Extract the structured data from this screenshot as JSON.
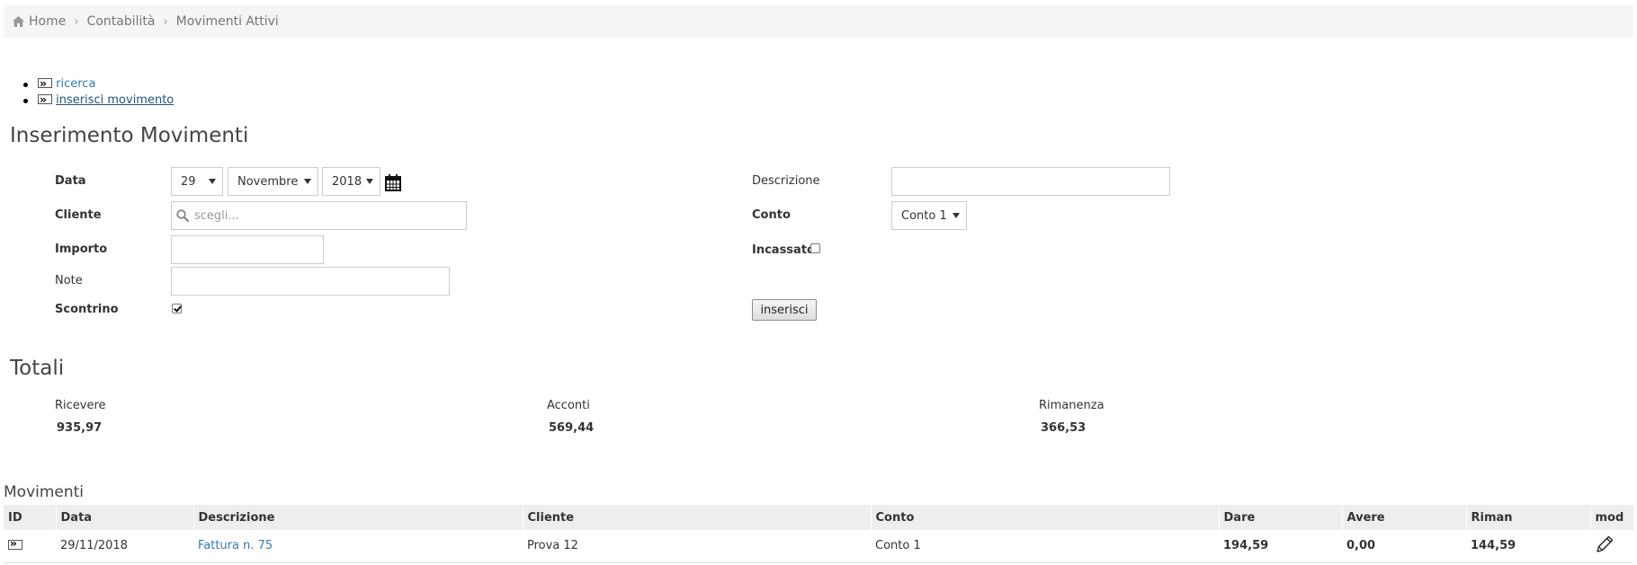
{
  "breadcrumb": {
    "home": "Home",
    "items": [
      "Contabilità",
      "Movimenti Attivi"
    ]
  },
  "links": {
    "search": "ricerca",
    "insert": "inserisci movimento"
  },
  "form": {
    "title": "Inserimento Movimenti",
    "date_label": "Data",
    "day": "29",
    "month": "Novembre",
    "year": "2018",
    "cliente_label": "Cliente",
    "cliente_placeholder": "scegli...",
    "importo_label": "Importo",
    "note_label": "Note",
    "scontrino_label": "Scontrino",
    "scontrino_checked": true,
    "descrizione_label": "Descrizione",
    "conto_label": "Conto",
    "conto_value": "Conto 1",
    "incassato_label": "Incassato",
    "incassato_checked": false,
    "submit_label": "inserisci"
  },
  "totals": {
    "title": "Totali",
    "ricevere_label": "Ricevere",
    "ricevere_value": "935,97",
    "acconti_label": "Acconti",
    "acconti_value": "569,44",
    "rimanenza_label": "Rimanenza",
    "rimanenza_value": "366,53"
  },
  "movimenti": {
    "title": "Movimenti",
    "columns": [
      "ID",
      "Data",
      "Descrizione",
      "Cliente",
      "Conto",
      "Dare",
      "Avere",
      "Riman",
      "mod"
    ],
    "rows": [
      {
        "data": "29/11/2018",
        "descrizione": "Fattura n. 75",
        "cliente": "Prova 12",
        "conto": "Conto 1",
        "dare": "194,59",
        "avere": "0,00",
        "riman": "144,59"
      }
    ]
  }
}
